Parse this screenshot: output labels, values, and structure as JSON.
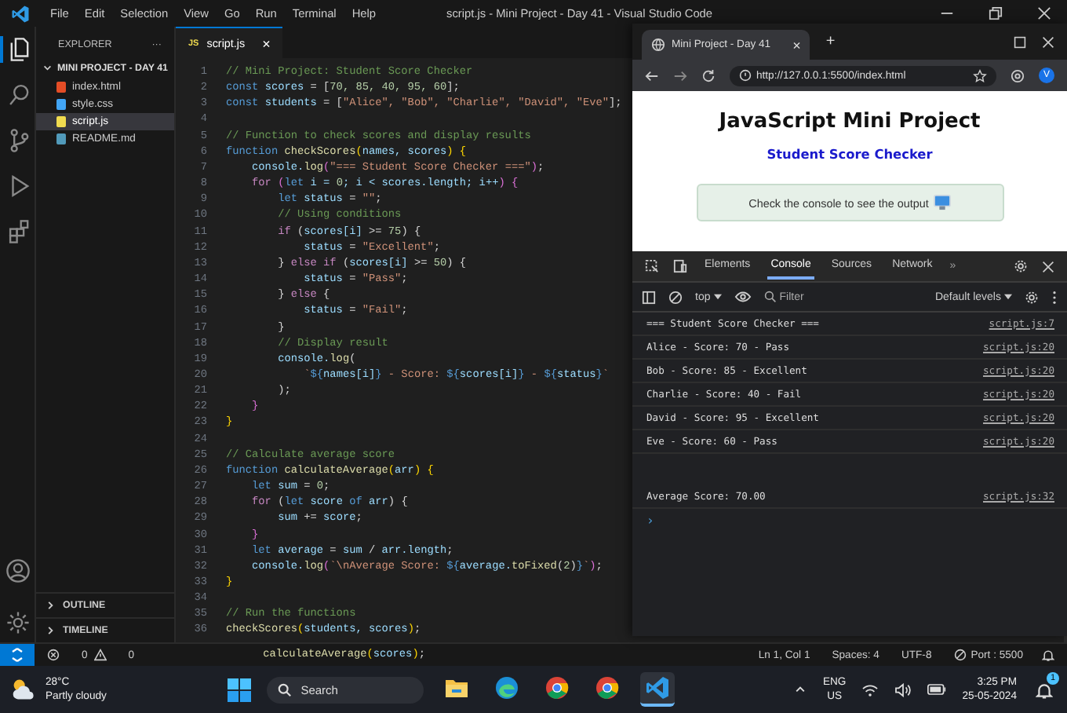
{
  "vscode": {
    "menu": [
      "File",
      "Edit",
      "Selection",
      "View",
      "Go",
      "Run",
      "Terminal",
      "Help"
    ],
    "title": "script.js - Mini Project - Day 41 - Visual Studio Code",
    "activity_bar": [
      {
        "kind": "files",
        "selected": true
      },
      {
        "kind": "search",
        "selected": false
      },
      {
        "kind": "source-control",
        "selected": false
      },
      {
        "kind": "run",
        "selected": false
      },
      {
        "kind": "extensions",
        "selected": false
      }
    ],
    "explorer": {
      "title": "EXPLORER",
      "more": "···",
      "folder": {
        "label": "MINI PROJECT - DAY 41",
        "expanded": true,
        "children": [
          {
            "label": "index.html",
            "kind": "html",
            "selected": false
          },
          {
            "label": "style.css",
            "kind": "css",
            "selected": false
          },
          {
            "label": "script.js",
            "kind": "js",
            "selected": true
          },
          {
            "label": "README.md",
            "kind": "md",
            "selected": false
          }
        ]
      },
      "sections": [
        {
          "label": "OUTLINE",
          "expanded": false
        },
        {
          "label": "TIMELINE",
          "expanded": false
        }
      ]
    },
    "tabs": [
      {
        "label": "script.js",
        "badge": "JS",
        "close": "×",
        "selected": true
      }
    ],
    "code": [
      {
        "number": "1",
        "tokens": [
          {
            "kind": "c",
            "text": "// Mini Project: Student Score Checker"
          }
        ]
      },
      {
        "number": "2",
        "tokens": [
          {
            "kind": "k",
            "text": "const "
          },
          {
            "kind": "v",
            "text": "scores"
          },
          {
            "kind": "p",
            "text": " = ["
          },
          {
            "kind": "n",
            "text": "70, 85, 40, 95, 60"
          },
          {
            "kind": "p",
            "text": "];"
          }
        ]
      },
      {
        "number": "3",
        "tokens": [
          {
            "kind": "k",
            "text": "const "
          },
          {
            "kind": "v",
            "text": "students"
          },
          {
            "kind": "p",
            "text": " = ["
          },
          {
            "kind": "s",
            "text": "\"Alice\", \"Bob\", \"Charlie\", \"David\", \"Eve\""
          },
          {
            "kind": "p",
            "text": "];"
          }
        ]
      },
      {
        "number": "4"
      },
      {
        "number": "5",
        "tokens": [
          {
            "kind": "c",
            "text": "// Function to check scores and display results"
          }
        ]
      },
      {
        "number": "6",
        "tokens": [
          {
            "kind": "k",
            "text": "function "
          },
          {
            "kind": "f",
            "text": "checkScores"
          },
          {
            "kind": "b",
            "text": "("
          },
          {
            "kind": "v",
            "text": "names, scores"
          },
          {
            "kind": "b",
            "text": ") {"
          }
        ]
      },
      {
        "number": "7",
        "tokens": [
          {
            "kind": "v",
            "text": "    console."
          },
          {
            "kind": "f",
            "text": "log"
          },
          {
            "kind": "q",
            "text": "("
          },
          {
            "kind": "s",
            "text": "\"=== Student Score Checker ===\""
          },
          {
            "kind": "q",
            "text": ")"
          },
          {
            "kind": "p",
            "text": ";"
          }
        ]
      },
      {
        "number": "8",
        "tokens": [
          {
            "kind": "r",
            "text": "    for "
          },
          {
            "kind": "q",
            "text": "("
          },
          {
            "kind": "k",
            "text": "let"
          },
          {
            "kind": "v",
            "text": " i = "
          },
          {
            "kind": "n",
            "text": "0"
          },
          {
            "kind": "v",
            "text": "; i < scores.length; i++"
          },
          {
            "kind": "q",
            "text": ") {"
          }
        ]
      },
      {
        "number": "9",
        "tokens": [
          {
            "kind": "k",
            "text": "        let "
          },
          {
            "kind": "v",
            "text": "status"
          },
          {
            "kind": "p",
            "text": " = "
          },
          {
            "kind": "s",
            "text": "\"\""
          },
          {
            "kind": "p",
            "text": ";"
          }
        ]
      },
      {
        "number": "10",
        "tokens": [
          {
            "kind": "c",
            "text": "        // Using conditions"
          }
        ]
      },
      {
        "number": "11",
        "tokens": [
          {
            "kind": "r",
            "text": "        if"
          },
          {
            "kind": "p",
            "text": " ("
          },
          {
            "kind": "v",
            "text": "scores[i]"
          },
          {
            "kind": "p",
            "text": " >= "
          },
          {
            "kind": "n",
            "text": "75"
          },
          {
            "kind": "p",
            "text": ") {"
          }
        ]
      },
      {
        "number": "12",
        "tokens": [
          {
            "kind": "v",
            "text": "            status"
          },
          {
            "kind": "p",
            "text": " = "
          },
          {
            "kind": "s",
            "text": "\"Excellent\""
          },
          {
            "kind": "p",
            "text": ";"
          }
        ]
      },
      {
        "number": "13",
        "tokens": [
          {
            "kind": "p",
            "text": "        } "
          },
          {
            "kind": "r",
            "text": "else if"
          },
          {
            "kind": "p",
            "text": " ("
          },
          {
            "kind": "v",
            "text": "scores[i]"
          },
          {
            "kind": "p",
            "text": " >= "
          },
          {
            "kind": "n",
            "text": "50"
          },
          {
            "kind": "p",
            "text": ") {"
          }
        ]
      },
      {
        "number": "14",
        "tokens": [
          {
            "kind": "v",
            "text": "            status"
          },
          {
            "kind": "p",
            "text": " = "
          },
          {
            "kind": "s",
            "text": "\"Pass\""
          },
          {
            "kind": "p",
            "text": ";"
          }
        ]
      },
      {
        "number": "15",
        "tokens": [
          {
            "kind": "p",
            "text": "        } "
          },
          {
            "kind": "r",
            "text": "else"
          },
          {
            "kind": "p",
            "text": " {"
          }
        ]
      },
      {
        "number": "16",
        "tokens": [
          {
            "kind": "v",
            "text": "            status"
          },
          {
            "kind": "p",
            "text": " = "
          },
          {
            "kind": "s",
            "text": "\"Fail\""
          },
          {
            "kind": "p",
            "text": ";"
          }
        ]
      },
      {
        "number": "17",
        "tokens": [
          {
            "kind": "p",
            "text": "        }"
          }
        ]
      },
      {
        "number": "18",
        "tokens": [
          {
            "kind": "c",
            "text": "        // Display result"
          }
        ]
      },
      {
        "number": "19",
        "tokens": [
          {
            "kind": "v",
            "text": "        console."
          },
          {
            "kind": "f",
            "text": "log"
          },
          {
            "kind": "p",
            "text": "("
          }
        ]
      },
      {
        "number": "20",
        "tokens": [
          {
            "kind": "s",
            "text": "            `"
          },
          {
            "kind": "k",
            "text": "${"
          },
          {
            "kind": "v",
            "text": "names[i]"
          },
          {
            "kind": "k",
            "text": "}"
          },
          {
            "kind": "s",
            "text": " - Score: "
          },
          {
            "kind": "k",
            "text": "${"
          },
          {
            "kind": "v",
            "text": "scores[i]"
          },
          {
            "kind": "k",
            "text": "}"
          },
          {
            "kind": "s",
            "text": " - "
          },
          {
            "kind": "k",
            "text": "${"
          },
          {
            "kind": "v",
            "text": "status"
          },
          {
            "kind": "k",
            "text": "}"
          },
          {
            "kind": "s",
            "text": "`"
          }
        ]
      },
      {
        "number": "21",
        "tokens": [
          {
            "kind": "p",
            "text": "        );"
          }
        ]
      },
      {
        "number": "22",
        "tokens": [
          {
            "kind": "q",
            "text": "    }"
          }
        ]
      },
      {
        "number": "23",
        "tokens": [
          {
            "kind": "b",
            "text": "}"
          }
        ]
      },
      {
        "number": "24"
      },
      {
        "number": "25",
        "tokens": [
          {
            "kind": "c",
            "text": "// Calculate average score"
          }
        ]
      },
      {
        "number": "26",
        "tokens": [
          {
            "kind": "k",
            "text": "function "
          },
          {
            "kind": "f",
            "text": "calculateAverage"
          },
          {
            "kind": "b",
            "text": "("
          },
          {
            "kind": "v",
            "text": "arr"
          },
          {
            "kind": "b",
            "text": ") {"
          }
        ]
      },
      {
        "number": "27",
        "tokens": [
          {
            "kind": "k",
            "text": "    let "
          },
          {
            "kind": "v",
            "text": "sum"
          },
          {
            "kind": "p",
            "text": " = "
          },
          {
            "kind": "n",
            "text": "0"
          },
          {
            "kind": "p",
            "text": ";"
          }
        ]
      },
      {
        "number": "28",
        "tokens": [
          {
            "kind": "r",
            "text": "    for"
          },
          {
            "kind": "p",
            "text": " ("
          },
          {
            "kind": "k",
            "text": "let "
          },
          {
            "kind": "v",
            "text": "score"
          },
          {
            "kind": "k",
            "text": " of "
          },
          {
            "kind": "v",
            "text": "arr"
          },
          {
            "kind": "p",
            "text": ") {"
          }
        ]
      },
      {
        "number": "29",
        "tokens": [
          {
            "kind": "v",
            "text": "        sum"
          },
          {
            "kind": "p",
            "text": " += "
          },
          {
            "kind": "v",
            "text": "score"
          },
          {
            "kind": "p",
            "text": ";"
          }
        ]
      },
      {
        "number": "30",
        "tokens": [
          {
            "kind": "q",
            "text": "    }"
          }
        ]
      },
      {
        "number": "31",
        "tokens": [
          {
            "kind": "k",
            "text": "    let "
          },
          {
            "kind": "v",
            "text": "average"
          },
          {
            "kind": "p",
            "text": " = "
          },
          {
            "kind": "v",
            "text": "sum"
          },
          {
            "kind": "p",
            "text": " / "
          },
          {
            "kind": "v",
            "text": "arr.length"
          },
          {
            "kind": "p",
            "text": ";"
          }
        ]
      },
      {
        "number": "32",
        "tokens": [
          {
            "kind": "v",
            "text": "    console."
          },
          {
            "kind": "f",
            "text": "log"
          },
          {
            "kind": "q",
            "text": "("
          },
          {
            "kind": "s",
            "text": "`\\nAverage Score: "
          },
          {
            "kind": "k",
            "text": "${"
          },
          {
            "kind": "v",
            "text": "average."
          },
          {
            "kind": "f",
            "text": "toFixed"
          },
          {
            "kind": "p",
            "text": "("
          },
          {
            "kind": "n",
            "text": "2"
          },
          {
            "kind": "p",
            "text": ")"
          },
          {
            "kind": "k",
            "text": "}"
          },
          {
            "kind": "s",
            "text": "`"
          },
          {
            "kind": "q",
            "text": ")"
          },
          {
            "kind": "p",
            "text": ";"
          }
        ]
      },
      {
        "number": "33",
        "tokens": [
          {
            "kind": "b",
            "text": "}"
          }
        ]
      },
      {
        "number": "34"
      },
      {
        "number": "35",
        "tokens": [
          {
            "kind": "c",
            "text": "// Run the functions"
          }
        ]
      },
      {
        "number": "36",
        "tokens": [
          {
            "kind": "f",
            "text": "checkScores"
          },
          {
            "kind": "b",
            "text": "("
          },
          {
            "kind": "v",
            "text": "students, scores"
          },
          {
            "kind": "b",
            "text": ")"
          },
          {
            "kind": "p",
            "text": ";"
          }
        ]
      }
    ],
    "status_bar": {
      "errors": "0",
      "warnings": "0",
      "overflow_code_line": [
        {
          "kind": "f",
          "text": "calculateAverage"
        },
        {
          "kind": "b",
          "text": "("
        },
        {
          "kind": "v",
          "text": "scores"
        },
        {
          "kind": "b",
          "text": ")"
        },
        {
          "kind": "p",
          "text": ";"
        }
      ],
      "position": "Ln 1, Col 1",
      "spaces": "Spaces: 4",
      "encoding": "UTF-8",
      "port": "Port : 5500"
    }
  },
  "browser": {
    "tabs": [
      {
        "label": "Mini Project - Day 41",
        "close": "×",
        "selected": true
      }
    ],
    "new_tab": "+",
    "url": "http://127.0.0.1:5500/index.html",
    "avatar": "V",
    "page": {
      "heading": "JavaScript Mini Project",
      "subheading": "Student Score Checker",
      "notice": "Check the console to see the output"
    },
    "devtools": {
      "tabs": [
        {
          "label": "Elements",
          "selected": false
        },
        {
          "label": "Console",
          "selected": true
        },
        {
          "label": "Sources",
          "selected": false
        },
        {
          "label": "Network",
          "selected": false
        }
      ],
      "more_tabs": "»",
      "context": "top",
      "filter_placeholder": "Filter",
      "levels": "Default levels",
      "messages": [
        {
          "text": "=== Student Score Checker ===",
          "source": "script.js:7"
        },
        {
          "text": "Alice - Score: 70 - Pass",
          "source": "script.js:20"
        },
        {
          "text": "Bob - Score: 85 - Excellent",
          "source": "script.js:20"
        },
        {
          "text": "Charlie - Score: 40 - Fail",
          "source": "script.js:20"
        },
        {
          "text": "David - Score: 95 - Excellent",
          "source": "script.js:20"
        },
        {
          "text": "Eve - Score: 60 - Pass",
          "source": "script.js:20"
        },
        {
          "text": "\nAverage Score: 70.00",
          "source": "script.js:32"
        }
      ],
      "prompt": "›"
    }
  },
  "taskbar": {
    "weather": {
      "temperature": "28°C",
      "condition": "Partly cloudy"
    },
    "search": "Search",
    "apps": [
      {
        "kind": "folder",
        "selected": false
      },
      {
        "kind": "edge",
        "selected": false
      },
      {
        "kind": "chrome",
        "selected": false
      },
      {
        "kind": "chrome",
        "selected": false
      },
      {
        "kind": "vscode",
        "selected": true
      }
    ],
    "language": "ENG",
    "region": "US",
    "time": "3:25 PM",
    "date": "25-05-2024",
    "notifications": "1"
  }
}
